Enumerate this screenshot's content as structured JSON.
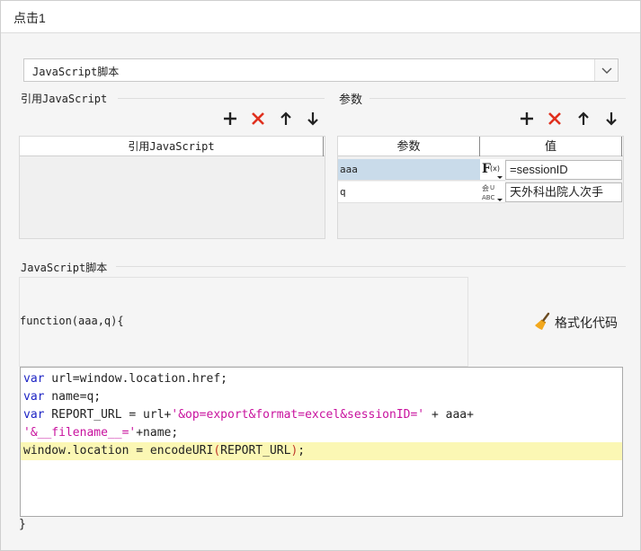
{
  "window": {
    "title": "点击1"
  },
  "script_type": {
    "selected": "JavaScript脚本"
  },
  "ref_js": {
    "section_label": "引用JavaScript",
    "column_header": "引用JavaScript",
    "rows": []
  },
  "params": {
    "section_label": "参数",
    "columns": {
      "name": "参数",
      "value": "值"
    },
    "rows": [
      {
        "name": "aaa",
        "type_icon": "formula-icon",
        "value": "=sessionID"
      },
      {
        "name": "q",
        "type_icon": "text-type-icon",
        "value": "天外科出院人次手"
      }
    ]
  },
  "script": {
    "section_label": "JavaScript脚本",
    "signature": "function(aaa,q){",
    "closing": "}",
    "format_label": "格式化代码",
    "code_lines": [
      [
        {
          "t": "kw",
          "v": "var"
        },
        {
          "t": "plain",
          "v": " url=window.location.href;"
        }
      ],
      [
        {
          "t": "kw",
          "v": "var"
        },
        {
          "t": "plain",
          "v": " name=q;"
        }
      ],
      [
        {
          "t": "kw",
          "v": "var"
        },
        {
          "t": "plain",
          "v": " REPORT_URL = url+"
        },
        {
          "t": "str",
          "v": "'&op=export&format=excel&sessionID='"
        },
        {
          "t": "plain",
          "v": " + aaa+"
        }
      ],
      [
        {
          "t": "str",
          "v": "'&__filename__='"
        },
        {
          "t": "plain",
          "v": "+name;"
        }
      ],
      [
        {
          "t": "plain",
          "v": "window.location = encodeURI"
        },
        {
          "t": "paren",
          "v": "("
        },
        {
          "t": "plain",
          "v": "REPORT_URL"
        },
        {
          "t": "paren",
          "v": ")"
        },
        {
          "t": "plain",
          "v": ";"
        }
      ]
    ],
    "highlighted_line": 5
  },
  "colors": {
    "add": "#222222",
    "delete": "#e0301e",
    "keyword": "#1d24c4",
    "string": "#c8129e",
    "line_highlight": "#fbf7b4",
    "selected_cell": "#c9dbea"
  }
}
